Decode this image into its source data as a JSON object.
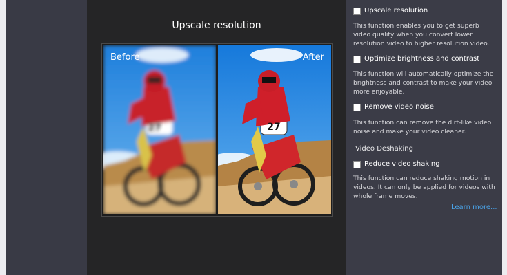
{
  "preview": {
    "title": "Upscale resolution",
    "before_label": "Before",
    "after_label": "After",
    "bike_number": "27"
  },
  "options": {
    "upscale": {
      "label": "Upscale resolution",
      "checked": false,
      "description": "This function enables you to get superb video quality when you convert lower resolution video to higher resolution video."
    },
    "brightness": {
      "label": "Optimize brightness and contrast",
      "checked": false,
      "description": "This function will automatically optimize the brightness and contrast to make your video more enjoyable."
    },
    "noise": {
      "label": "Remove video noise",
      "checked": false,
      "description": "This function can remove the dirt-like video noise and make your video cleaner."
    },
    "deshake_section": "Video Deshaking",
    "deshake": {
      "label": "Reduce video shaking",
      "checked": false,
      "description": "This function can reduce shaking motion in videos. It can only be applied for videos with whole frame moves."
    }
  },
  "learn_more": "Learn more...",
  "colors": {
    "panel_dark": "#393a45",
    "preview_bg": "#252526",
    "link": "#4aa3e8",
    "sky": "#2f8fe0",
    "sand": "#c9a060"
  },
  "icons": [
    "checkbox-icon"
  ]
}
